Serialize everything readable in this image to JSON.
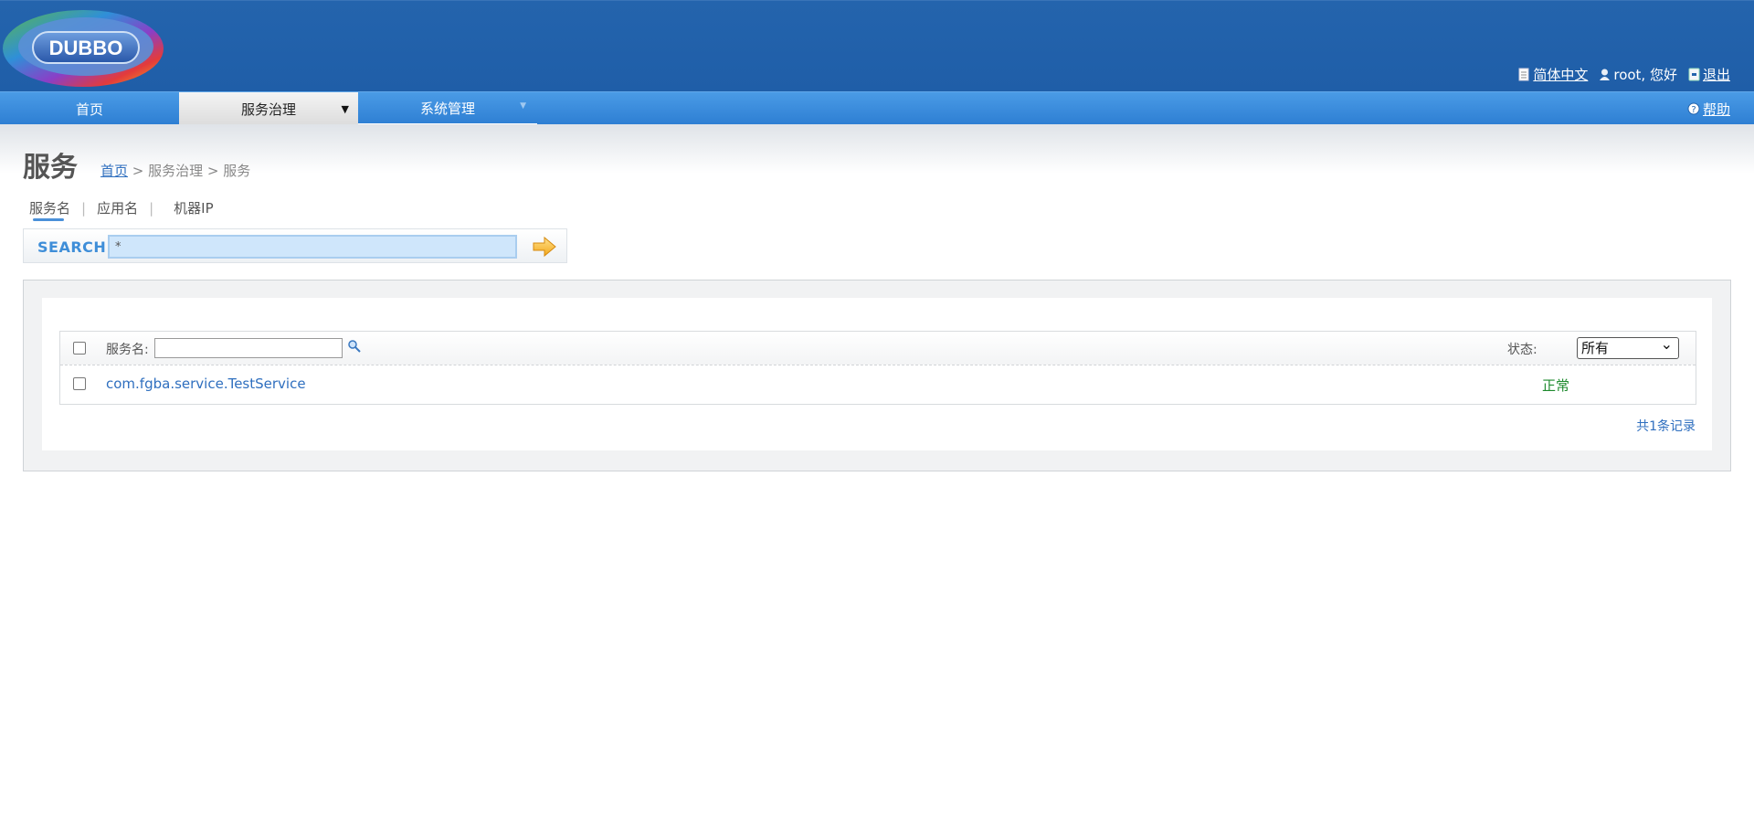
{
  "header": {
    "logo_text": "DUBBO",
    "language_link": "简体中文",
    "user_greeting": "root, 您好",
    "logout_link": "退出"
  },
  "nav": {
    "items": [
      {
        "label": "首页",
        "active": false
      },
      {
        "label": "服务治理",
        "active": true
      },
      {
        "label": "系统管理",
        "active": false
      }
    ],
    "help_link": "帮助"
  },
  "page": {
    "title": "服务",
    "breadcrumb": {
      "home": "首页",
      "rest": " > 服务治理 > 服务"
    }
  },
  "search": {
    "tabs": [
      "服务名",
      "应用名",
      "机器IP"
    ],
    "active_tab": "服务名",
    "label": "SEARCH",
    "value": "*"
  },
  "table": {
    "column_label": "服务名:",
    "filter_value": "",
    "status_label": "状态:",
    "status_selected": "所有",
    "rows": [
      {
        "service": "com.fgba.service.TestService",
        "status": "正常"
      }
    ],
    "total": "共1条记录"
  },
  "colors": {
    "header_bg": "#2464ad",
    "nav_bg": "#3a8ddd",
    "link": "#2f6fbf",
    "status_ok": "#1e8a2e"
  }
}
